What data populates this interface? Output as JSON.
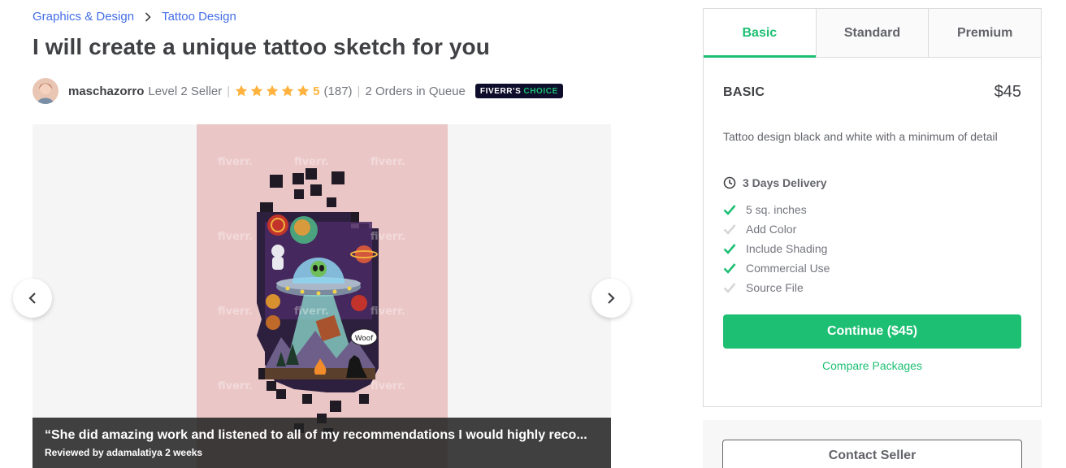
{
  "breadcrumb": {
    "items": [
      "Graphics & Design",
      "Tattoo Design"
    ]
  },
  "gig": {
    "title": "I will create a unique tattoo sketch for you"
  },
  "seller": {
    "name": "maschazorro",
    "level": "Level 2 Seller",
    "stars": 5,
    "rating": "5",
    "reviews_count": "(187)",
    "queue": "2 Orders in Queue",
    "badge_prefix": "FIVERR'S",
    "badge_suffix": "CHOICE"
  },
  "gallery": {
    "watermark": "fiverr.",
    "speech_bubble": "Woof",
    "review_quote": "“She did amazing work and listened to all of my recommendations I would highly reco...",
    "review_meta": "Reviewed by adamalatiya 2 weeks"
  },
  "packages": {
    "tabs": [
      "Basic",
      "Standard",
      "Premium"
    ],
    "active_tab": "Basic",
    "name": "BASIC",
    "price": "$45",
    "description": "Tattoo design black and white with a minimum of detail",
    "delivery": "3 Days Delivery",
    "features": [
      {
        "label": "5 sq. inches",
        "included": true
      },
      {
        "label": "Add Color",
        "included": false
      },
      {
        "label": "Include Shading",
        "included": true
      },
      {
        "label": "Commercial Use",
        "included": true
      },
      {
        "label": "Source File",
        "included": false
      }
    ],
    "continue_label": "Continue ($45)",
    "compare_label": "Compare Packages",
    "contact_label": "Contact Seller"
  },
  "colors": {
    "accent_green": "#1dbf73",
    "link_blue": "#446ee7",
    "star_yellow": "#ffb33e",
    "image_bg": "#ebc6c7"
  }
}
